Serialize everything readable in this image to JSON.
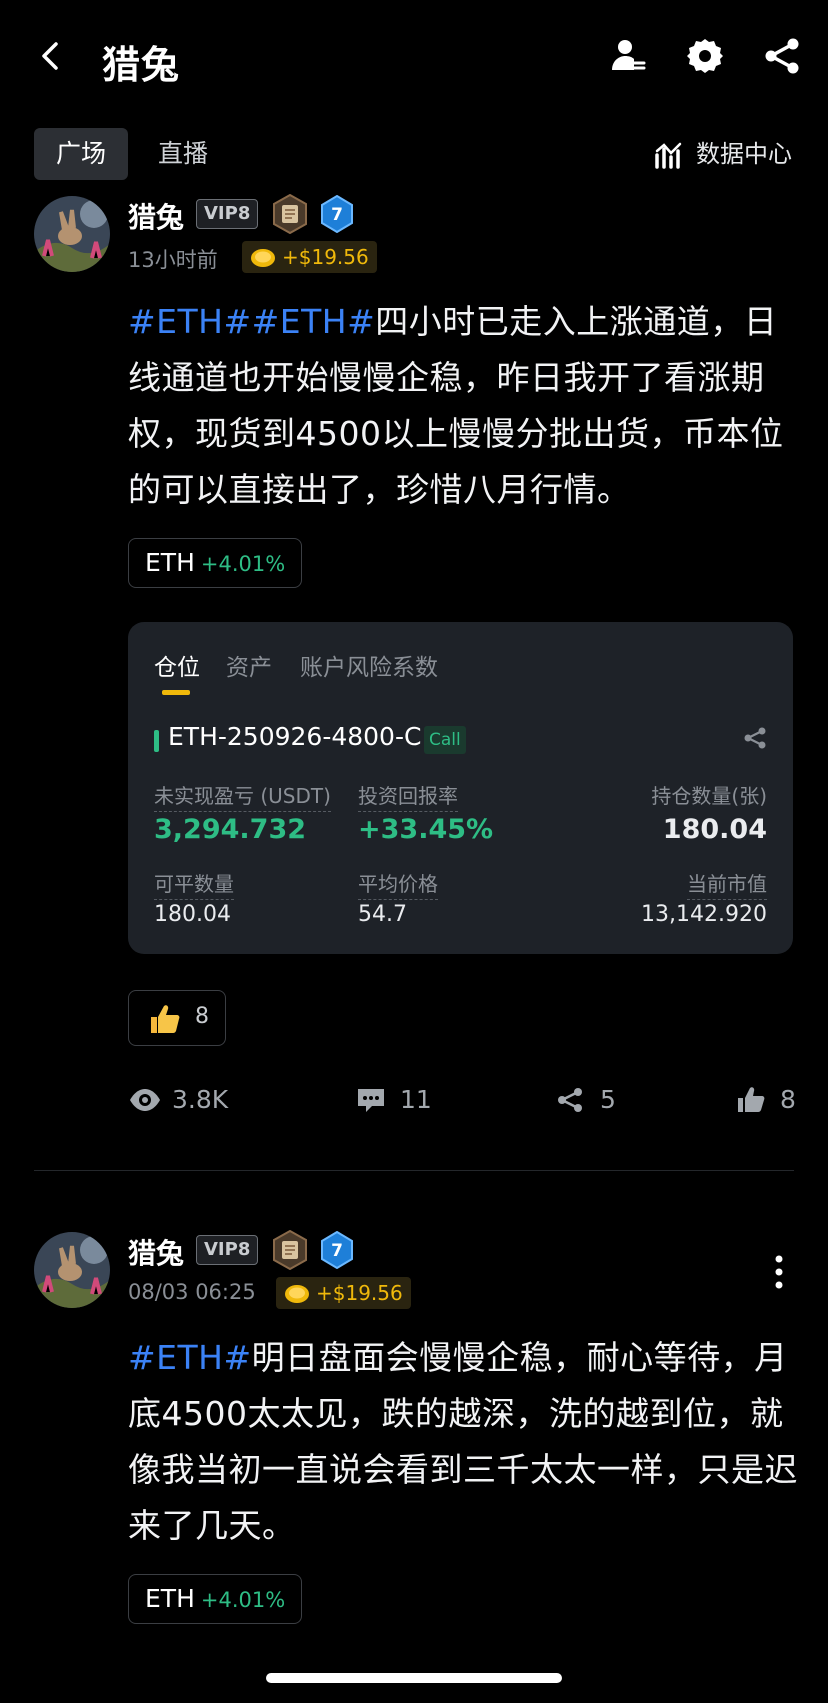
{
  "header": {
    "title": "猎兔",
    "icons": [
      "back-icon",
      "user-manage-icon",
      "settings-icon",
      "share-icon"
    ]
  },
  "tabs": [
    {
      "label": "广场",
      "active": true
    },
    {
      "label": "直播",
      "active": false
    }
  ],
  "data_center_label": "数据中心",
  "post1": {
    "username": "猎兔",
    "vip": "VIP8",
    "level": "7",
    "time": "13小时前",
    "tip": "+$19.56",
    "tag1": "#ETH#",
    "tag2": "#ETH#",
    "text": "四小时已走入上涨通道，日线通道也开始慢慢企稳，昨日我开了看涨期权，现货到4500以上慢慢分批出货，币本位的可以直接出了，珍惜八月行情。",
    "ticker": "ETH",
    "ticker_change": "+4.01%",
    "card": {
      "tabs": [
        "仓位",
        "资产",
        "账户风险系数"
      ],
      "instrument": "ETH-250926-4800-C",
      "type": "Call",
      "pnl_label": "未实现盈亏 (USDT)",
      "pnl_value": "3,294.732",
      "roi_label": "投资回报率",
      "roi_value": "+33.45%",
      "qty_label": "持仓数量(张)",
      "qty_value": "180.04",
      "closable_label": "可平数量",
      "closable_value": "180.04",
      "avg_label": "平均价格",
      "avg_value": "54.7",
      "mv_label": "当前市值",
      "mv_value": "13,142.920"
    },
    "reaction_count": "8",
    "stats": {
      "views": "3.8K",
      "comments": "11",
      "shares": "5",
      "likes": "8"
    }
  },
  "post2": {
    "username": "猎兔",
    "vip": "VIP8",
    "level": "7",
    "time": "08/03 06:25",
    "tip": "+$19.56",
    "tag1": "#ETH#",
    "text": "明日盘面会慢慢企稳，耐心等待，月底4500太太见，跌的越深，洗的越到位，就像我当初一直说会看到三千太太一样，只是迟来了几天。",
    "ticker": "ETH",
    "ticker_change": "+4.01%"
  },
  "colors": {
    "accent": "#f0b90b",
    "up": "#2ebd85",
    "tag": "#3b82f6",
    "background": "#000000",
    "card": "#1e2228"
  }
}
